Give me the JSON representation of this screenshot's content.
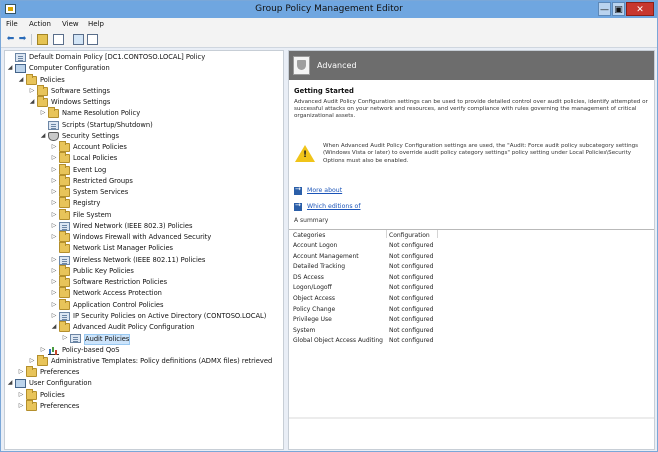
{
  "window": {
    "title": "Group Policy Management Editor",
    "minimize": "—",
    "maximize": "▣",
    "close": "✕"
  },
  "menu": [
    "File",
    "Action",
    "View",
    "Help"
  ],
  "toolbar": {
    "back": "⬅",
    "forward": "➡"
  },
  "tree": [
    {
      "label": "Default Domain Policy [DC1.CONTOSO.LOCAL] Policy",
      "level": 0,
      "expander": "",
      "icon": "policy"
    },
    {
      "label": "Computer Configuration",
      "level": 0,
      "expander": "◢",
      "icon": "computer"
    },
    {
      "label": "Policies",
      "level": 1,
      "expander": "◢",
      "icon": "folder"
    },
    {
      "label": "Software Settings",
      "level": 2,
      "expander": "▷",
      "icon": "folder"
    },
    {
      "label": "Windows Settings",
      "level": 2,
      "expander": "◢",
      "icon": "folder"
    },
    {
      "label": "Name Resolution Policy",
      "level": 3,
      "expander": "▷",
      "icon": "folder"
    },
    {
      "label": "Scripts (Startup/Shutdown)",
      "level": 3,
      "expander": "",
      "icon": "policy"
    },
    {
      "label": "Security Settings",
      "level": 3,
      "expander": "◢",
      "icon": "shield"
    },
    {
      "label": "Account Policies",
      "level": 4,
      "expander": "▷",
      "icon": "folder"
    },
    {
      "label": "Local Policies",
      "level": 4,
      "expander": "▷",
      "icon": "folder"
    },
    {
      "label": "Event Log",
      "level": 4,
      "expander": "▷",
      "icon": "folder"
    },
    {
      "label": "Restricted Groups",
      "level": 4,
      "expander": "▷",
      "icon": "folder"
    },
    {
      "label": "System Services",
      "level": 4,
      "expander": "▷",
      "icon": "folder"
    },
    {
      "label": "Registry",
      "level": 4,
      "expander": "▷",
      "icon": "folder"
    },
    {
      "label": "File System",
      "level": 4,
      "expander": "▷",
      "icon": "folder"
    },
    {
      "label": "Wired Network (IEEE 802.3) Policies",
      "level": 4,
      "expander": "▷",
      "icon": "policy"
    },
    {
      "label": "Windows Firewall with Advanced Security",
      "level": 4,
      "expander": "▷",
      "icon": "folder"
    },
    {
      "label": "Network List Manager Policies",
      "level": 4,
      "expander": "",
      "icon": "folder"
    },
    {
      "label": "Wireless Network (IEEE 802.11) Policies",
      "level": 4,
      "expander": "▷",
      "icon": "policy"
    },
    {
      "label": "Public Key Policies",
      "level": 4,
      "expander": "▷",
      "icon": "folder"
    },
    {
      "label": "Software Restriction Policies",
      "level": 4,
      "expander": "▷",
      "icon": "folder"
    },
    {
      "label": "Network Access Protection",
      "level": 4,
      "expander": "▷",
      "icon": "folder"
    },
    {
      "label": "Application Control Policies",
      "level": 4,
      "expander": "▷",
      "icon": "folder"
    },
    {
      "label": "IP Security Policies on Active Directory (CONTOSO.LOCAL)",
      "level": 4,
      "expander": "▷",
      "icon": "policy"
    },
    {
      "label": "Advanced Audit Policy Configuration",
      "level": 4,
      "expander": "◢",
      "icon": "folder"
    },
    {
      "label": "Audit Policies",
      "level": 5,
      "expander": "▷",
      "icon": "policy",
      "selected": true
    },
    {
      "label": "Policy-based QoS",
      "level": 3,
      "expander": "▷",
      "icon": "chart"
    },
    {
      "label": "Administrative Templates: Policy definitions (ADMX files) retrieved",
      "level": 2,
      "expander": "▷",
      "icon": "folder"
    },
    {
      "label": "Preferences",
      "level": 1,
      "expander": "▷",
      "icon": "folder"
    },
    {
      "label": "User Configuration",
      "level": 0,
      "expander": "◢",
      "icon": "computer"
    },
    {
      "label": "Policies",
      "level": 1,
      "expander": "▷",
      "icon": "folder"
    },
    {
      "label": "Preferences",
      "level": 1,
      "expander": "▷",
      "icon": "folder"
    }
  ],
  "details": {
    "banner_title": "Advanced",
    "section_title": "Getting Started",
    "intro": "Advanced Audit Policy Configuration settings can be used to provide detailed control over audit policies, identify attempted or successful attacks on your network and resources, and verify compliance with rules governing the management of critical organizational assets.",
    "warning": "When Advanced Audit Policy Configuration settings are used, the \"Audit: Force audit policy subcategory settings (Windows Vista or later) to override audit policy category settings\" policy setting under Local Policies\\Security Options must also be enabled.",
    "link_more": "More about",
    "link_editions": "Which editions of",
    "summary_label": "A summary",
    "columns": [
      "Categories",
      "Configuration"
    ],
    "rows": [
      [
        "Account Logon",
        "Not configured"
      ],
      [
        "Account Management",
        "Not configured"
      ],
      [
        "Detailed Tracking",
        "Not configured"
      ],
      [
        "DS Access",
        "Not configured"
      ],
      [
        "Logon/Logoff",
        "Not configured"
      ],
      [
        "Object Access",
        "Not configured"
      ],
      [
        "Policy Change",
        "Not configured"
      ],
      [
        "Privilege Use",
        "Not configured"
      ],
      [
        "System",
        "Not configured"
      ],
      [
        "Global Object Access Auditing",
        "Not configured"
      ]
    ]
  }
}
